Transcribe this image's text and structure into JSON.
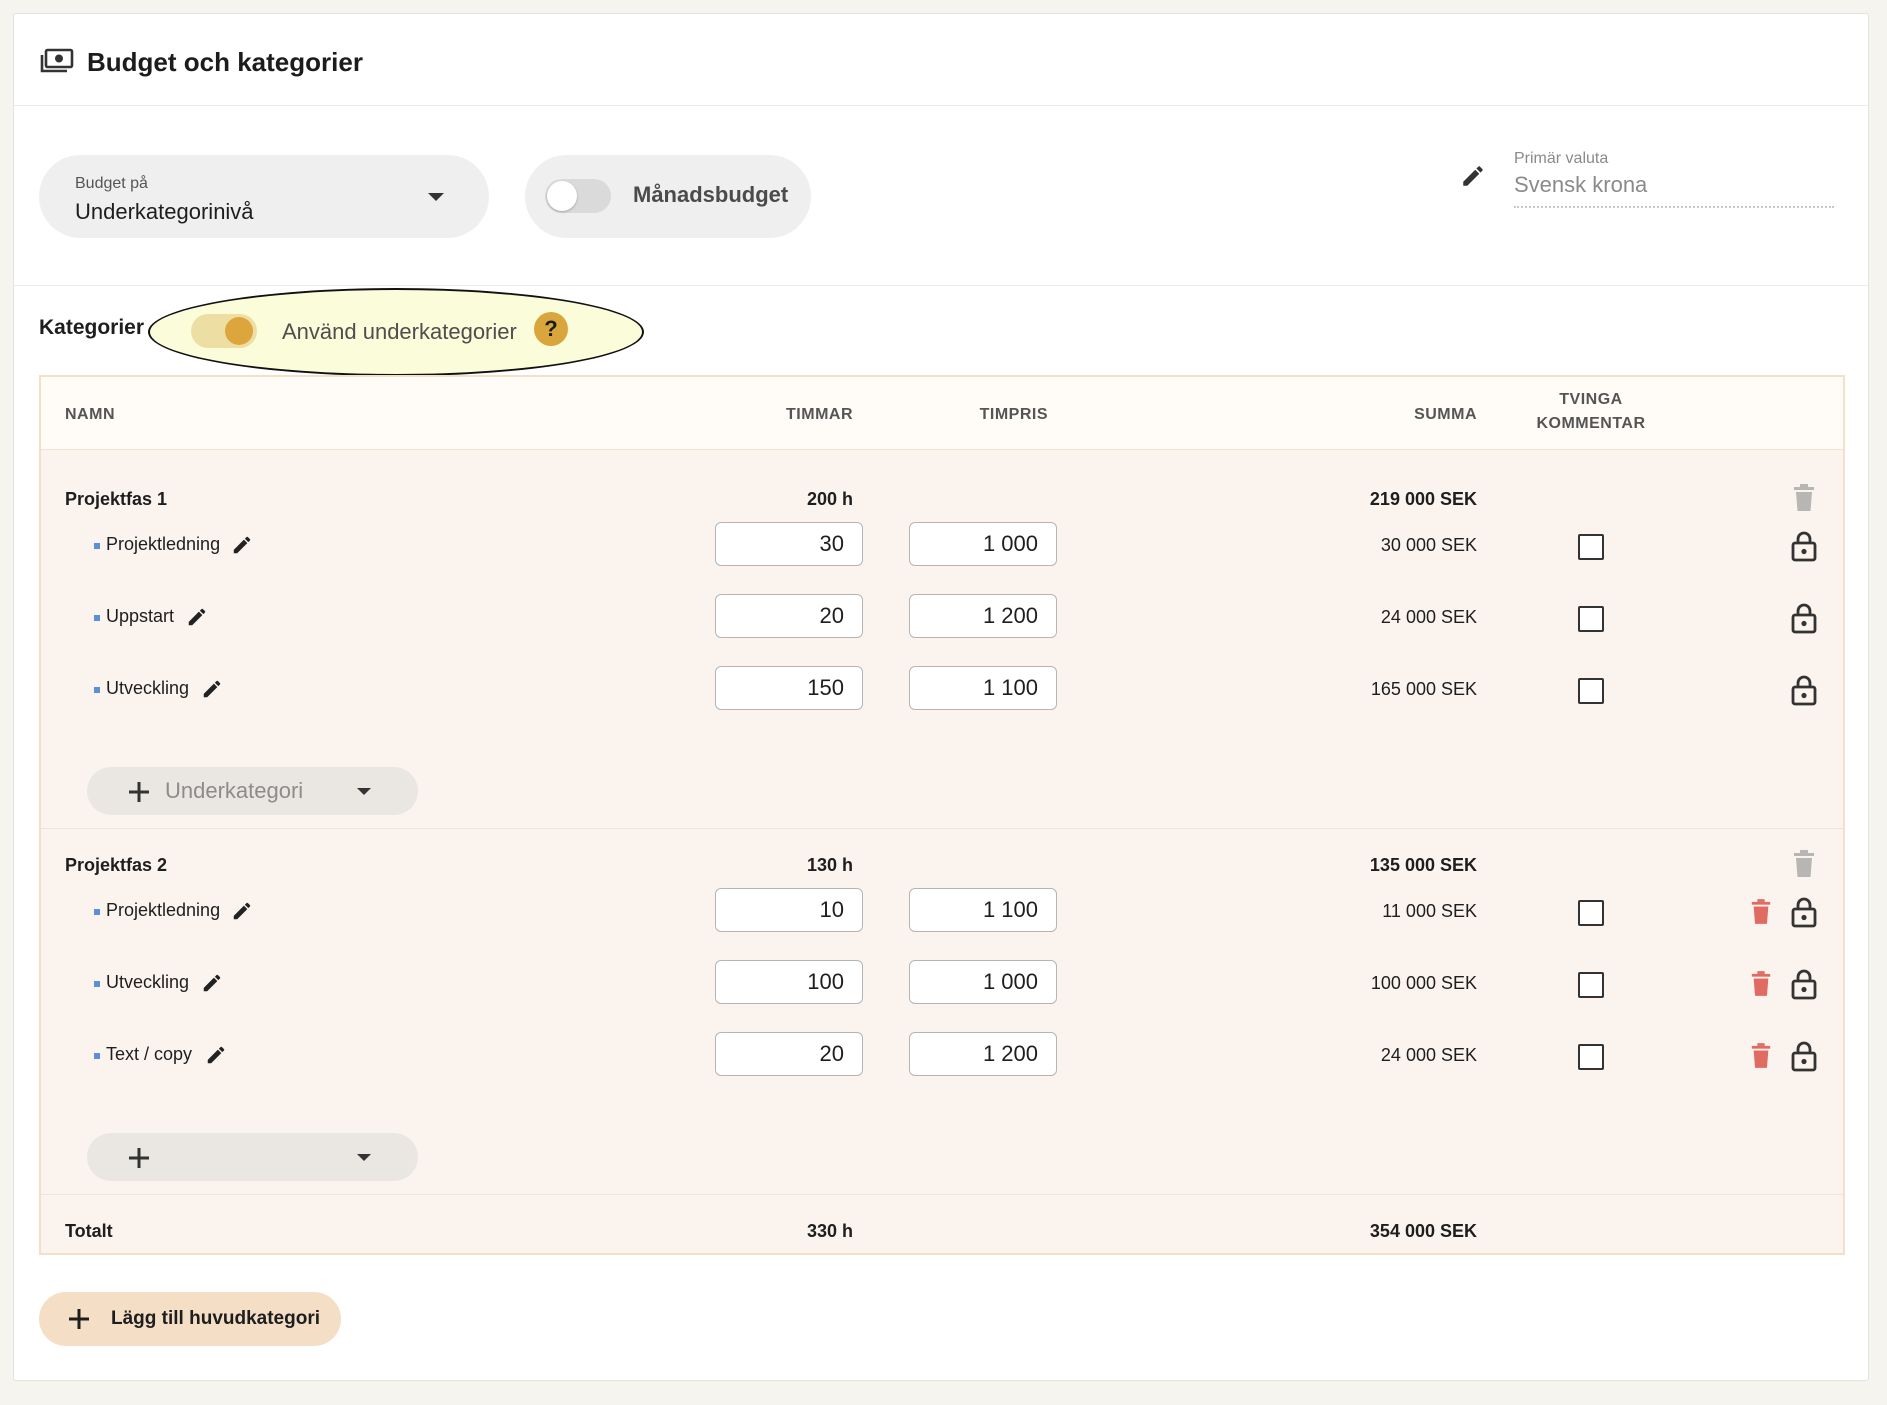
{
  "header": {
    "title": "Budget och kategorier",
    "icon": "money-icon"
  },
  "settings": {
    "budget_level_label": "Budget på",
    "budget_level_value": "Underkategorinivå",
    "monthly_budget_label": "Månadsbudget",
    "monthly_budget_enabled": false,
    "currency_label": "Primär valuta",
    "currency_value": "Svensk krona"
  },
  "categories": {
    "title": "Kategorier",
    "use_subcategories_label": "Använd underkategorier",
    "use_subcategories_enabled": true,
    "help_glyph": "?"
  },
  "table": {
    "headers": {
      "name": "NAMN",
      "hours": "TIMMAR",
      "rate": "TIMPRIS",
      "sum": "SUMMA",
      "force_comment_1": "TVINGA",
      "force_comment_2": "KOMMENTAR"
    },
    "groups": [
      {
        "name": "Projektfas 1",
        "hours": "200 h",
        "sum": "219 000 SEK",
        "rows": [
          {
            "name": "Projektledning",
            "hours": "30",
            "rate": "1 000",
            "sum": "30 000 SEK"
          },
          {
            "name": "Uppstart",
            "hours": "20",
            "rate": "1 200",
            "sum": "24 000 SEK"
          },
          {
            "name": "Utveckling",
            "hours": "150",
            "rate": "1 100",
            "sum": "165 000 SEK"
          }
        ],
        "add_label": "Underkategori"
      },
      {
        "name": "Projektfas 2",
        "hours": "130 h",
        "sum": "135 000 SEK",
        "rows": [
          {
            "name": "Projektledning",
            "hours": "10",
            "rate": "1 100",
            "sum": "11 000 SEK"
          },
          {
            "name": "Utveckling",
            "hours": "100",
            "rate": "1 000",
            "sum": "100 000 SEK"
          },
          {
            "name": "Text / copy",
            "hours": "20",
            "rate": "1 200",
            "sum": "24 000 SEK"
          }
        ],
        "add_label": ""
      }
    ],
    "total": {
      "label": "Totalt",
      "hours": "330 h",
      "sum": "354 000 SEK"
    }
  },
  "add_main_category_label": "Lägg till huvudkategori",
  "colors": {
    "accent": "#dca63c",
    "row_bg": "#fbf4ee",
    "table_border": "#f4dfc8",
    "delete_red": "#e06b63",
    "bullet_blue": "#5b8fd6"
  }
}
